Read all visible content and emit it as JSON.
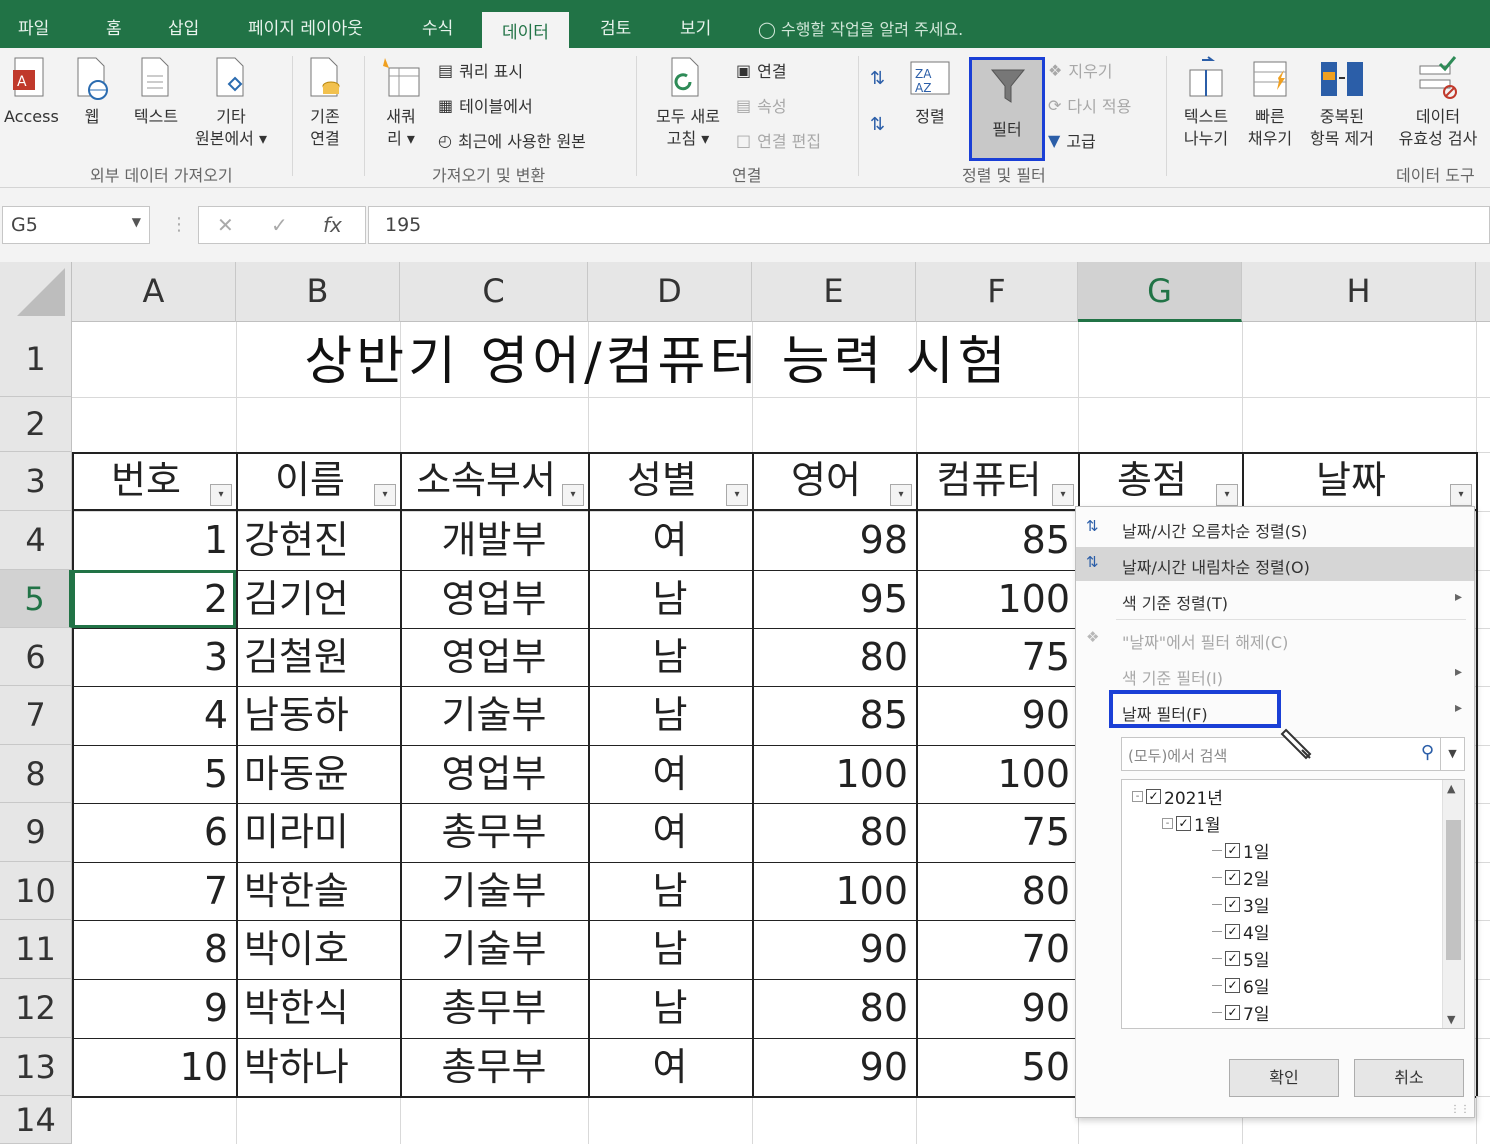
{
  "ribbon_tabs": [
    "파일",
    "홈",
    "삽입",
    "페이지 레이아웃",
    "수식",
    "데이터",
    "검토",
    "보기"
  ],
  "tell_me": "수행할 작업을 알려 주세요.",
  "ribbon": {
    "ext_data": {
      "access": "Access",
      "web": "웹",
      "text": "텍스트",
      "other_1": "기타",
      "other_2": "원본에서 ▾",
      "group": "외부 데이터 가져오기"
    },
    "existing": {
      "l1": "기존",
      "l2": "연결"
    },
    "get_transform": {
      "new_q1": "새쿼",
      "new_q2": "리 ▾",
      "show_queries": "쿼리 표시",
      "from_table": "테이블에서",
      "recent_sources": "최근에 사용한 원본",
      "group": "가져오기 및 변환"
    },
    "connections": {
      "refresh1": "모두 새로",
      "refresh2": "고침 ▾",
      "connections": "연결",
      "properties": "속성",
      "edit_links": "연결 편집",
      "group": "연결"
    },
    "sort_filter": {
      "sort": "정렬",
      "filter": "필터",
      "clear": "지우기",
      "reapply": "다시 적용",
      "advanced": "고급",
      "group": "정렬 및 필터"
    },
    "data_tools": {
      "t2c_1": "텍스트",
      "t2c_2": "나누기",
      "flash_1": "빠른",
      "flash_2": "채우기",
      "dup_1": "중복된",
      "dup_2": "항목 제거",
      "valid_1": "데이터",
      "valid_2": "유효성 검사",
      "group": "데이터 도구"
    }
  },
  "formula_bar": {
    "name_box": "G5",
    "value": "195"
  },
  "columns": [
    "A",
    "B",
    "C",
    "D",
    "E",
    "F",
    "G",
    "H"
  ],
  "selected_column": "G",
  "rows": [
    "1",
    "2",
    "3",
    "4",
    "5",
    "6",
    "7",
    "8",
    "9",
    "10",
    "11",
    "12",
    "13",
    "14"
  ],
  "selected_row": "5",
  "sheet_title": "상반기 영어/컴퓨터 능력 시험",
  "headers": [
    "번호",
    "이름",
    "소속부서",
    "성별",
    "영어",
    "컴퓨터",
    "총점",
    "날짜"
  ],
  "data_rows": [
    {
      "no": "1",
      "name": "강현진",
      "dept": "개발부",
      "gender": "여",
      "eng": "98",
      "comp": "85"
    },
    {
      "no": "2",
      "name": "김기언",
      "dept": "영업부",
      "gender": "남",
      "eng": "95",
      "comp": "100"
    },
    {
      "no": "3",
      "name": "김철원",
      "dept": "영업부",
      "gender": "남",
      "eng": "80",
      "comp": "75"
    },
    {
      "no": "4",
      "name": "남동하",
      "dept": "기술부",
      "gender": "남",
      "eng": "85",
      "comp": "90"
    },
    {
      "no": "5",
      "name": "마동윤",
      "dept": "영업부",
      "gender": "여",
      "eng": "100",
      "comp": "100"
    },
    {
      "no": "6",
      "name": "미라미",
      "dept": "총무부",
      "gender": "여",
      "eng": "80",
      "comp": "75"
    },
    {
      "no": "7",
      "name": "박한솔",
      "dept": "기술부",
      "gender": "남",
      "eng": "100",
      "comp": "80"
    },
    {
      "no": "8",
      "name": "박이호",
      "dept": "기술부",
      "gender": "남",
      "eng": "90",
      "comp": "70"
    },
    {
      "no": "9",
      "name": "박한식",
      "dept": "총무부",
      "gender": "남",
      "eng": "80",
      "comp": "90"
    },
    {
      "no": "10",
      "name": "박하나",
      "dept": "총무부",
      "gender": "여",
      "eng": "90",
      "comp": "50"
    }
  ],
  "filter_menu": {
    "sort_asc": "날짜/시간 오름차순 정렬(S)",
    "sort_desc": "날짜/시간 내림차순 정렬(O)",
    "sort_by_color": "색 기준 정렬(T)",
    "clear_filter": "\"날짜\"에서 필터 해제(C)",
    "filter_by_color": "색 기준 필터(I)",
    "date_filters": "날짜 필터(F)",
    "search_placeholder": "(모두)에서 검색",
    "tree": [
      {
        "label": "2021년",
        "checked": true,
        "level": 0
      },
      {
        "label": "1월",
        "checked": true,
        "level": 1
      },
      {
        "label": "1일",
        "checked": true,
        "level": 2
      },
      {
        "label": "2일",
        "checked": true,
        "level": 2
      },
      {
        "label": "3일",
        "checked": true,
        "level": 2
      },
      {
        "label": "4일",
        "checked": true,
        "level": 2
      },
      {
        "label": "5일",
        "checked": true,
        "level": 2
      },
      {
        "label": "6일",
        "checked": true,
        "level": 2
      },
      {
        "label": "7일",
        "checked": true,
        "level": 2
      }
    ],
    "ok": "확인",
    "cancel": "취소"
  },
  "colors": {
    "excel_green": "#217346",
    "highlight_box": "#1a3fd6"
  }
}
